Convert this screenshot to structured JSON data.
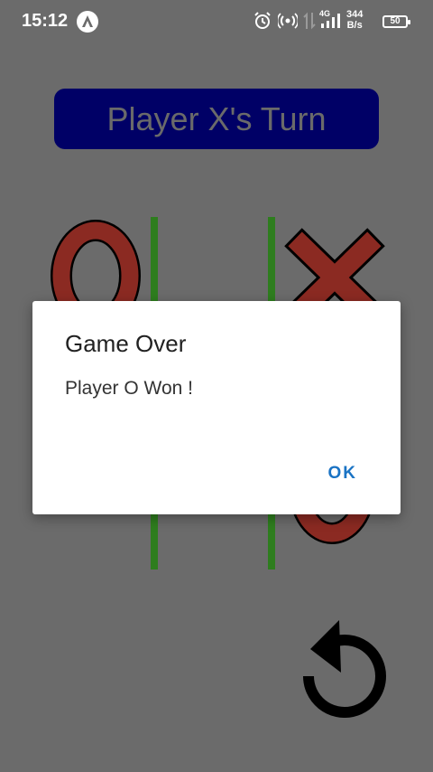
{
  "status_bar": {
    "time": "15:12",
    "network_type": "4G",
    "net_rate_value": "344",
    "net_rate_unit": "B/s",
    "battery_level": "50",
    "icons": [
      "app-notification-icon",
      "alarm-icon",
      "hotspot-icon",
      "data-transfer-icon",
      "signal-icon",
      "battery-icon"
    ]
  },
  "game": {
    "turn_banner": "Player X's Turn",
    "board": [
      [
        "O",
        "",
        "X"
      ],
      [
        "",
        "",
        ""
      ],
      [
        "",
        "",
        "O"
      ]
    ]
  },
  "dialog": {
    "title": "Game Over",
    "message": "Player O Won !",
    "ok_label": "OK"
  },
  "controls": {
    "restart_icon": "restart-icon"
  },
  "colors": {
    "background": "#6b6b6b",
    "banner": "#000066",
    "grid_line": "#2e7d1e",
    "mark_fill": "#8b2a22",
    "dialog_button": "#1a73c4"
  }
}
